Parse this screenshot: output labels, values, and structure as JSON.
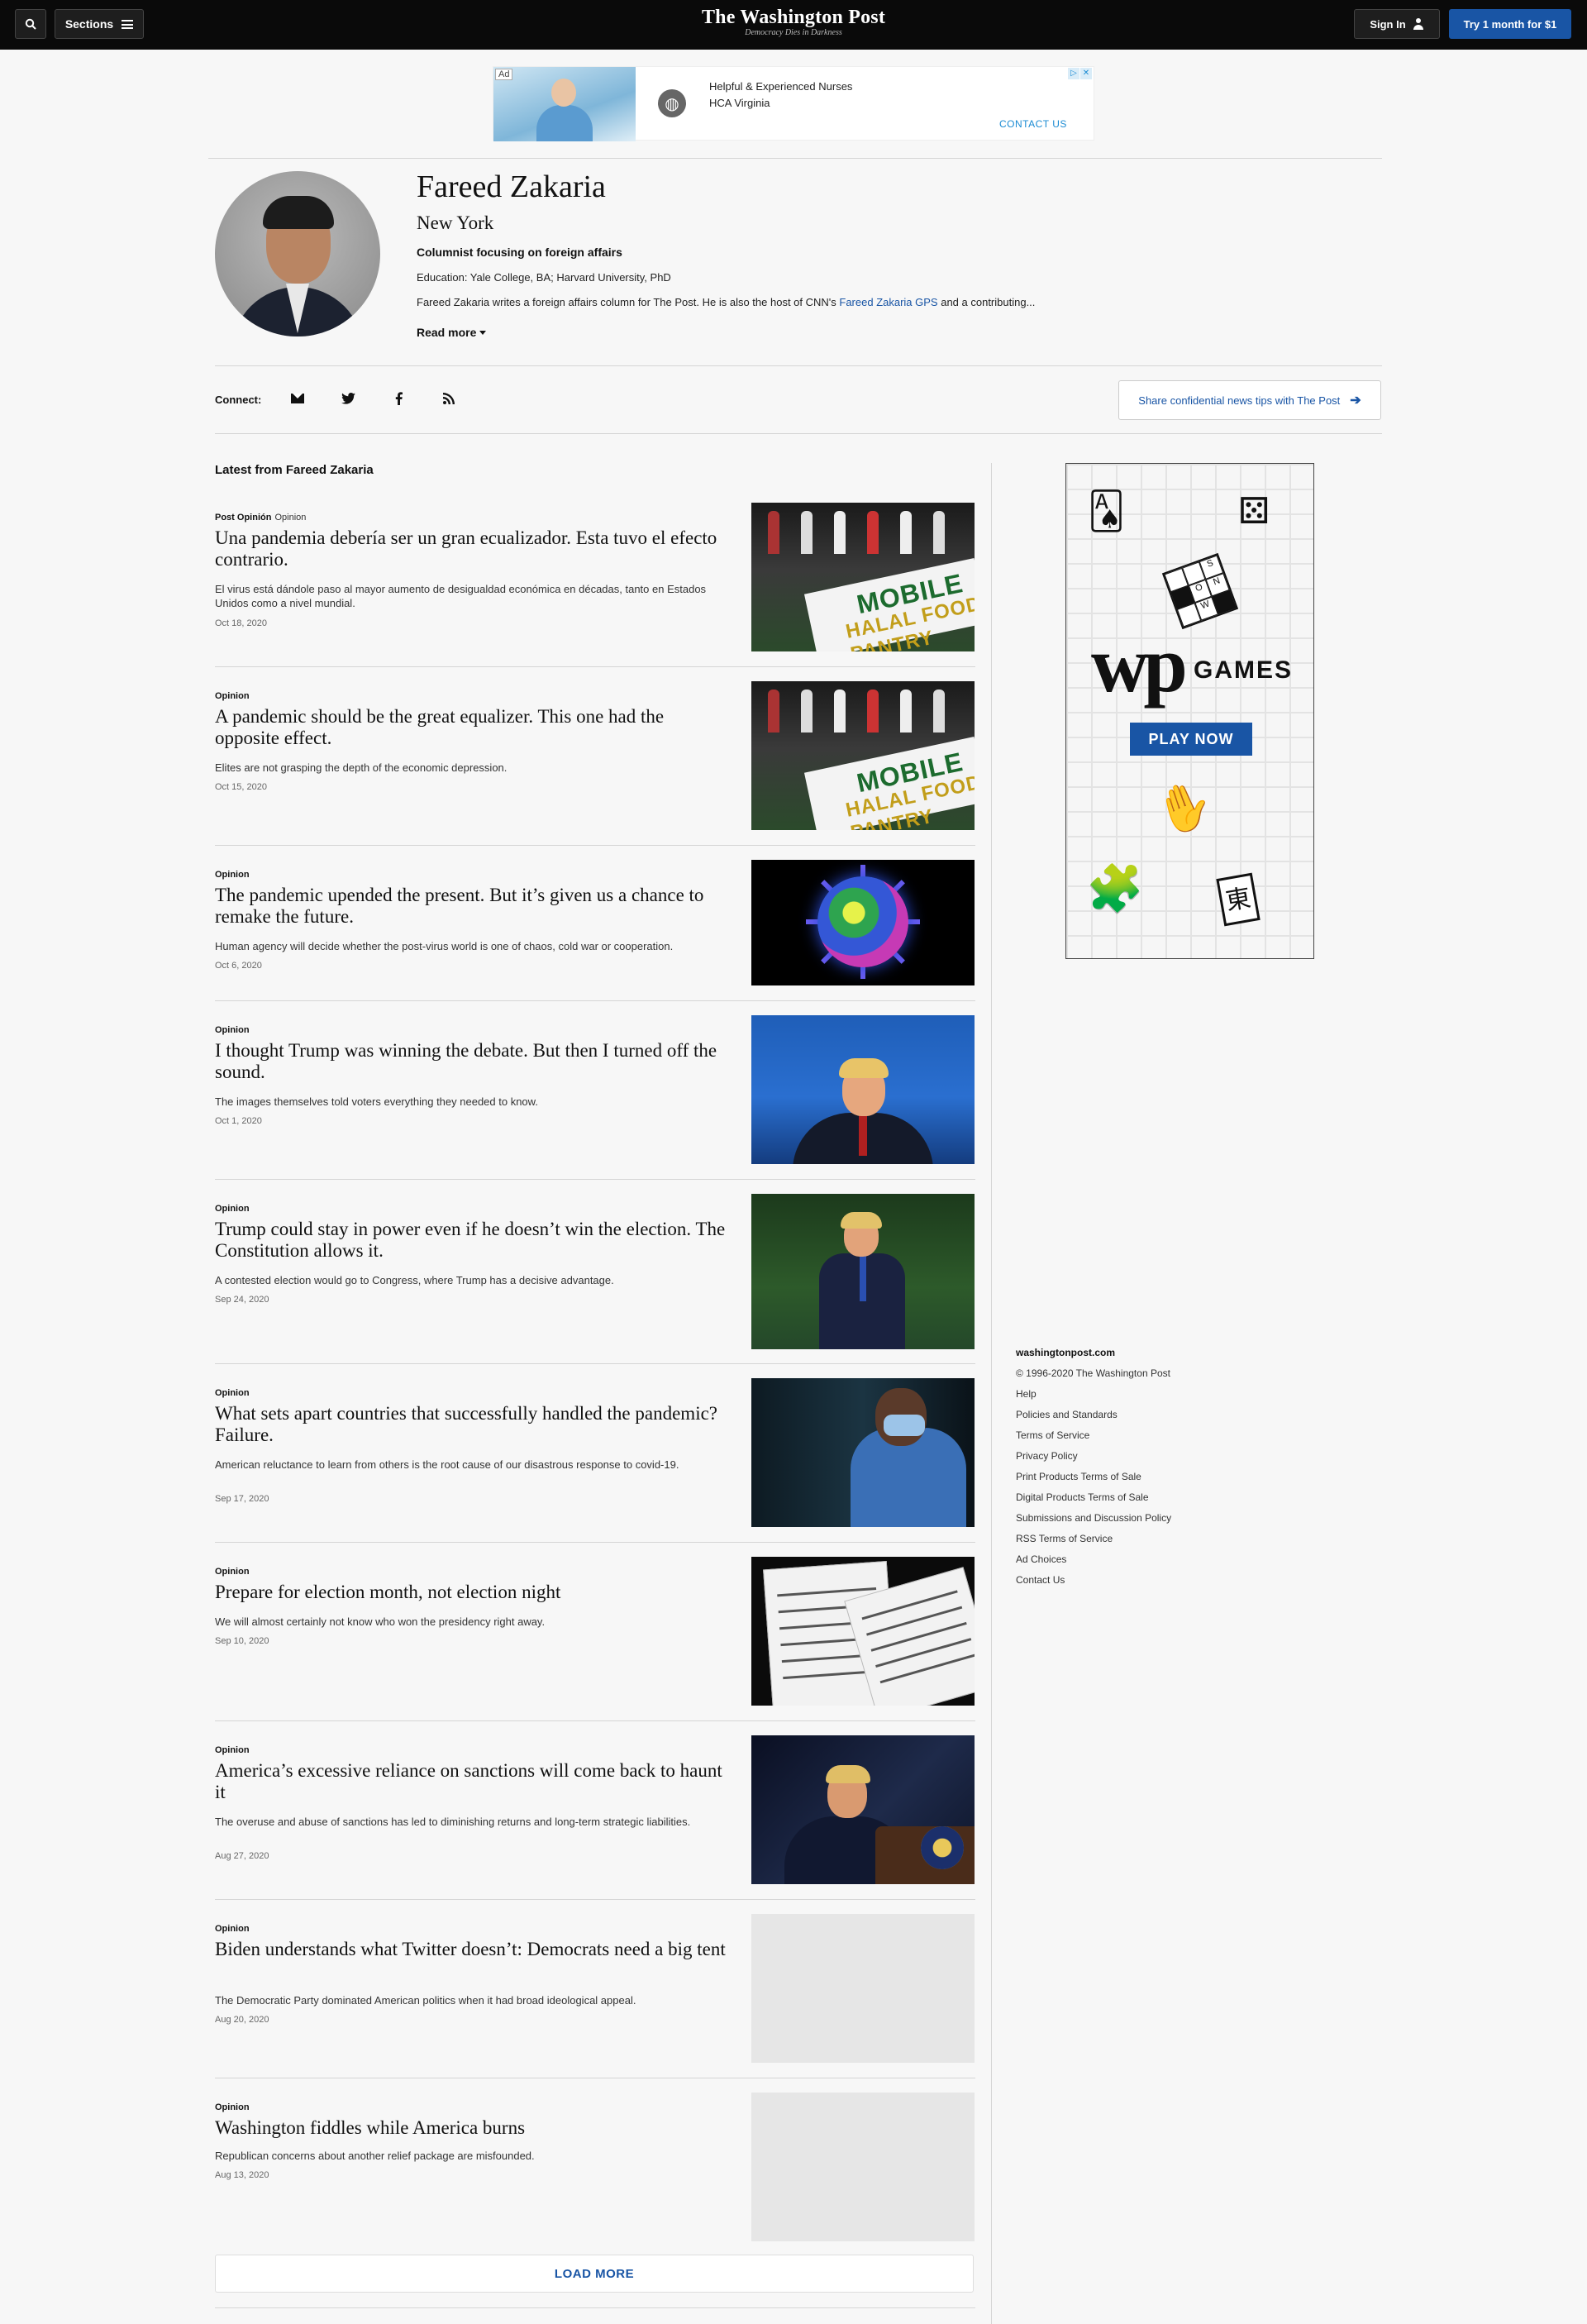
{
  "topbar": {
    "sections_label": "Sections",
    "brand_name": "The Washington Post",
    "brand_tagline": "Democracy Dies in Darkness",
    "signin_label": "Sign In",
    "subscribe_label": "Try 1 month for $1",
    "icons": [
      "search-icon",
      "hamburger-icon",
      "person-icon"
    ]
  },
  "ad_banner": {
    "badge": "Ad",
    "line1": "Helpful & Experienced Nurses",
    "line2": "HCA Virginia",
    "cta": "CONTACT US",
    "close_glyphs": [
      "▷",
      "✕"
    ]
  },
  "author": {
    "name": "Fareed Zakaria",
    "location": "New York",
    "role": "Columnist focusing on foreign affairs",
    "education": "Education: Yale College, BA; Harvard University, PhD",
    "bio_prefix": "Fareed Zakaria writes a foreign affairs column for The Post. He is also the host of CNN's ",
    "bio_link": "Fareed Zakaria GPS",
    "bio_suffix": " and a contributing...",
    "read_more": "Read more"
  },
  "connect": {
    "label": "Connect:",
    "icons": [
      "mail-icon",
      "twitter-icon",
      "facebook-icon",
      "rss-icon"
    ],
    "tips_label": "Share confidential news tips with The Post"
  },
  "latest_title": "Latest from Fareed Zakaria",
  "articles": [
    {
      "kicker": "Post Opinión",
      "tag": "Opinion",
      "headline": "Una pandemia debería ser un gran ecualizador. Esta tuvo el efecto contrario.",
      "blurb": "El virus está dándole paso al mayor aumento de desigualdad económica en décadas, tanto en Estados Unidos como a nivel mundial.",
      "date": "Oct 18, 2020"
    },
    {
      "kicker": "Opinion",
      "tag": "",
      "headline": "A pandemic should be the great equalizer. This one had the opposite effect.",
      "blurb": "Elites are not grasping the depth of the economic depression.",
      "date": "Oct 15, 2020"
    },
    {
      "kicker": "Opinion",
      "tag": "",
      "headline": "The pandemic upended the present. But it’s given us a chance to remake the future.",
      "blurb": "Human agency will decide whether the post-virus world is one of chaos, cold war or cooperation.",
      "date": "Oct 6, 2020"
    },
    {
      "kicker": "Opinion",
      "tag": "",
      "headline": "I thought Trump was winning the debate. But then I turned off the sound.",
      "blurb": "The images themselves told voters everything they needed to know.",
      "date": "Oct 1, 2020"
    },
    {
      "kicker": "Opinion",
      "tag": "",
      "headline": "Trump could stay in power even if he doesn’t win the election. The Constitution allows it.",
      "blurb": "A contested election would go to Congress, where Trump has a decisive advantage.",
      "date": "Sep 24, 2020"
    },
    {
      "kicker": "Opinion",
      "tag": "",
      "headline": "What sets apart countries that successfully handled the pandemic? Failure.",
      "blurb": "American reluctance to learn from others is the root cause of our disastrous response to covid-19.",
      "date": "Sep 17, 2020"
    },
    {
      "kicker": "Opinion",
      "tag": "",
      "headline": "Prepare for election month, not election night",
      "blurb": "We will almost certainly not know who won the presidency right away.",
      "date": "Sep 10, 2020"
    },
    {
      "kicker": "Opinion",
      "tag": "",
      "headline": "America’s excessive reliance on sanctions will come back to haunt it",
      "blurb": "The overuse and abuse of sanctions has led to diminishing returns and long-term strategic liabilities.",
      "date": "Aug 27, 2020"
    },
    {
      "kicker": "Opinion",
      "tag": "",
      "headline": "Biden understands what Twitter doesn’t: Democrats need a big tent",
      "blurb": "The Democratic Party dominated American politics when it had broad ideological appeal.",
      "date": "Aug 20, 2020"
    },
    {
      "kicker": "Opinion",
      "tag": "",
      "headline": "Washington fiddles while America burns",
      "blurb": "Republican concerns about another relief package are misfounded.",
      "date": "Aug 13, 2020"
    }
  ],
  "load_more": "LOAD MORE",
  "games_ad": {
    "brand": "wp",
    "word": "GAMES",
    "cta": "PLAY NOW",
    "crossword_letters": [
      "S",
      "O",
      "N",
      "W"
    ],
    "mahjong_glyph": "東"
  },
  "footer": {
    "site": "washingtonpost.com",
    "items": [
      "© 1996-2020 The Washington Post",
      "Help",
      "Policies and Standards",
      "Terms of Service",
      "Privacy Policy",
      "Print Products Terms of Sale",
      "Digital Products Terms of Sale",
      "Submissions and Discussion Policy",
      "RSS Terms of Service",
      "Ad Choices",
      "Contact Us"
    ]
  }
}
